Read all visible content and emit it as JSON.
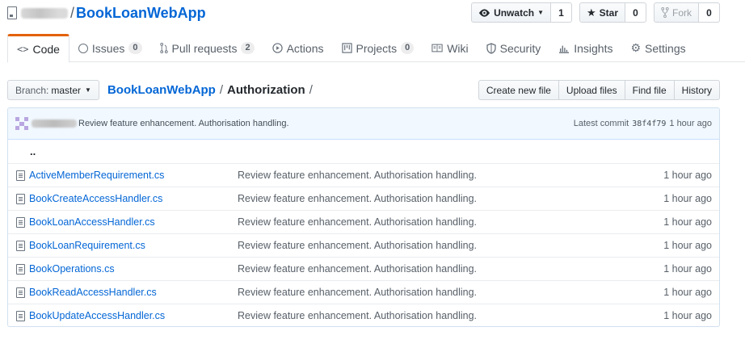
{
  "repo": {
    "name": "BookLoanWebApp",
    "separator": "/"
  },
  "header_actions": {
    "watch": {
      "label": "Unwatch",
      "count": "1"
    },
    "star": {
      "label": "Star",
      "count": "0"
    },
    "fork": {
      "label": "Fork",
      "count": "0"
    }
  },
  "tabs": [
    {
      "label": "Code",
      "icon": "code-icon"
    },
    {
      "label": "Issues",
      "icon": "issue-icon",
      "count": "0"
    },
    {
      "label": "Pull requests",
      "icon": "pull-request-icon",
      "count": "2"
    },
    {
      "label": "Actions",
      "icon": "play-icon"
    },
    {
      "label": "Projects",
      "icon": "project-icon",
      "count": "0"
    },
    {
      "label": "Wiki",
      "icon": "book-icon"
    },
    {
      "label": "Security",
      "icon": "shield-icon"
    },
    {
      "label": "Insights",
      "icon": "graph-icon"
    },
    {
      "label": "Settings",
      "icon": "gear-icon"
    }
  ],
  "branch": {
    "label": "Branch:",
    "value": "master"
  },
  "breadcrumb": {
    "root": "BookLoanWebApp",
    "sep": "/",
    "current": "Authorization",
    "trail": "/"
  },
  "file_buttons": [
    "Create new file",
    "Upload files",
    "Find file",
    "History"
  ],
  "latest_commit": {
    "message": "Review feature enhancement. Authorisation handling.",
    "label": "Latest commit",
    "sha": "38f4f79",
    "age": "1 hour ago"
  },
  "parent_dir": "..",
  "files": [
    {
      "name": "ActiveMemberRequirement.cs",
      "message": "Review feature enhancement. Authorisation handling.",
      "age": "1 hour ago"
    },
    {
      "name": "BookCreateAccessHandler.cs",
      "message": "Review feature enhancement. Authorisation handling.",
      "age": "1 hour ago"
    },
    {
      "name": "BookLoanAccessHandler.cs",
      "message": "Review feature enhancement. Authorisation handling.",
      "age": "1 hour ago"
    },
    {
      "name": "BookLoanRequirement.cs",
      "message": "Review feature enhancement. Authorisation handling.",
      "age": "1 hour ago"
    },
    {
      "name": "BookOperations.cs",
      "message": "Review feature enhancement. Authorisation handling.",
      "age": "1 hour ago"
    },
    {
      "name": "BookReadAccessHandler.cs",
      "message": "Review feature enhancement. Authorisation handling.",
      "age": "1 hour ago"
    },
    {
      "name": "BookUpdateAccessHandler.cs",
      "message": "Review feature enhancement. Authorisation handling.",
      "age": "1 hour ago"
    }
  ],
  "colors": {
    "link": "#0366d6",
    "selected_tab_accent": "#e36209",
    "commit_bar": "#f1f8ff"
  }
}
